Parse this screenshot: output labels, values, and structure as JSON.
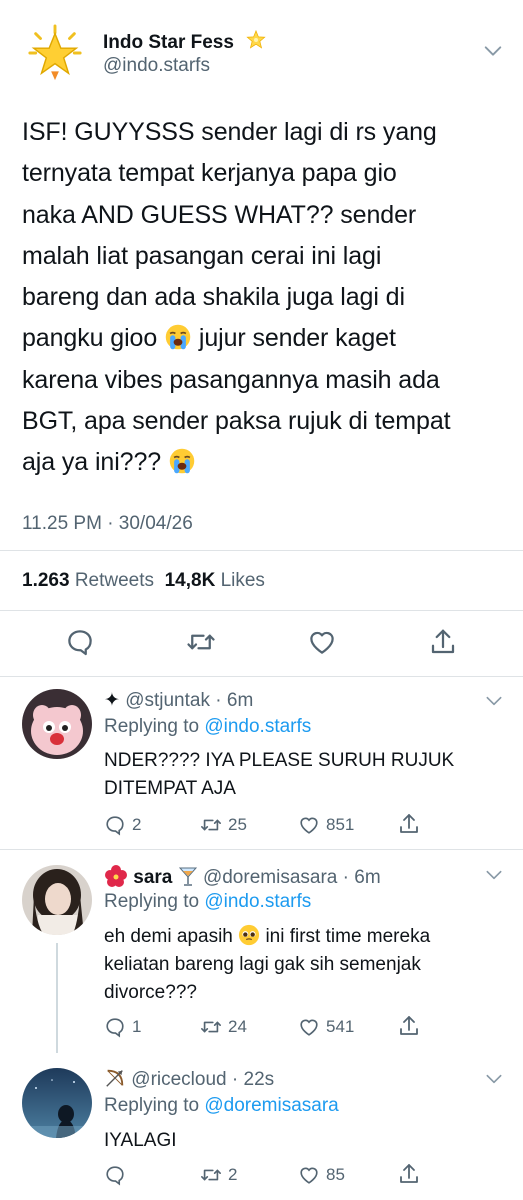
{
  "main_tweet": {
    "name": "Indo Star Fess",
    "handle": "@indo.starfs",
    "text_lines": [
      "ISF! GUYYSSS sender lagi di rs yang",
      "ternyata tempat kerjanya papa gio",
      "naka AND GUESS WHAT?? sender",
      "malah liat pasangan cerai ini lagi",
      "bareng dan ada shakila juga lagi di"
    ],
    "line6_a": "pangku gioo",
    "line6_b": "jujur sender kaget",
    "line7": "karena vibes pasangannya masih ada",
    "line8": "BGT, apa sender paksa rujuk di tempat",
    "line9": "aja ya ini???",
    "timestamp": "11.25 PM · 30/04/26",
    "retweets_count": "1.263",
    "retweets_label": "Retweets",
    "likes_count": "14,8K",
    "likes_label": "Likes"
  },
  "replies": [
    {
      "prefix": "✦",
      "name": "",
      "handle": "@stjuntak",
      "time": "· 6m",
      "replying_label": "Replying to",
      "replying_to": "@indo.starfs",
      "text_lines": [
        "NDER???? IYA PLEASE SURUH RUJUK",
        "DITEMPAT AJA"
      ],
      "replies": "2",
      "retweets": "25",
      "likes": "851"
    },
    {
      "name": "sara",
      "handle": "@doremisasara",
      "time": "· 6m",
      "replying_label": "Replying to",
      "replying_to": "@indo.starfs",
      "text_a": "eh demi apasih",
      "text_b": "ini first time mereka",
      "text_lines": [
        "keliatan bareng lagi gak sih semenjak",
        "divorce???"
      ],
      "replies": "1",
      "retweets": "24",
      "likes": "541"
    },
    {
      "name": "",
      "handle": "@ricecloud",
      "time": "· 22s",
      "replying_label": "Replying to",
      "replying_to": "@doremisasara",
      "text_lines": [
        "IYALAGI"
      ],
      "replies": "",
      "retweets": "2",
      "likes": "85"
    }
  ],
  "colors": {
    "text": "#0f1419",
    "secondary": "#536471",
    "link": "#1d9bf0",
    "divider": "#dfe3e6"
  },
  "icons": [
    "star-icon",
    "chevron-down-icon",
    "reply-icon",
    "retweet-icon",
    "like-icon",
    "share-icon",
    "crying-face-emoji",
    "pleading-face-emoji",
    "hibiscus-emoji",
    "cocktail-emoji",
    "bow-arrow-emoji"
  ]
}
